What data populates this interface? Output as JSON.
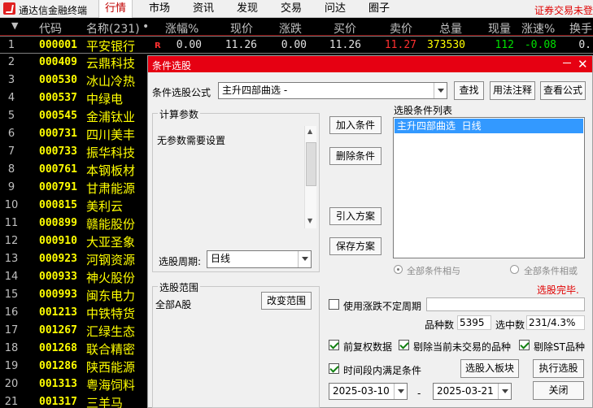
{
  "app": {
    "title": "通达信金融终端",
    "menus": [
      "行情",
      "市场",
      "资讯",
      "发现",
      "交易",
      "问达",
      "圈子"
    ],
    "active_menu": "行情",
    "right_note": "证券交易未登"
  },
  "columns": {
    "sort_arrow": "▼",
    "code": "代码",
    "name": "名称(231)",
    "dot": "•",
    "pct": "涨幅%",
    "price": "现价",
    "chg": "涨跌",
    "bid": "买价",
    "ask": "卖价",
    "vol": "总量",
    "cur": "现量",
    "speed": "涨速%",
    "turn": "换手"
  },
  "stocks": [
    {
      "idx": "1",
      "code": "000001",
      "name": "平安银行",
      "mark": "R",
      "pct": "0.00",
      "price": "11.26",
      "chg": "0.00",
      "bid": "11.26",
      "ask": "11.27",
      "vol": "373530",
      "cur": "112",
      "speed": "-0.08",
      "turn": "0."
    },
    {
      "idx": "2",
      "code": "000409",
      "name": "云鼎科技"
    },
    {
      "idx": "3",
      "code": "000530",
      "name": "冰山冷热"
    },
    {
      "idx": "4",
      "code": "000537",
      "name": "中绿电"
    },
    {
      "idx": "5",
      "code": "000545",
      "name": "金浦钛业"
    },
    {
      "idx": "6",
      "code": "000731",
      "name": "四川美丰"
    },
    {
      "idx": "7",
      "code": "000733",
      "name": "振华科技"
    },
    {
      "idx": "8",
      "code": "000761",
      "name": "本钢板材"
    },
    {
      "idx": "9",
      "code": "000791",
      "name": "甘肃能源"
    },
    {
      "idx": "10",
      "code": "000815",
      "name": "美利云"
    },
    {
      "idx": "11",
      "code": "000899",
      "name": "赣能股份"
    },
    {
      "idx": "12",
      "code": "000910",
      "name": "大亚圣象"
    },
    {
      "idx": "13",
      "code": "000923",
      "name": "河钢资源"
    },
    {
      "idx": "14",
      "code": "000933",
      "name": "神火股份"
    },
    {
      "idx": "15",
      "code": "000993",
      "name": "闽东电力"
    },
    {
      "idx": "16",
      "code": "001213",
      "name": "中铁特货"
    },
    {
      "idx": "17",
      "code": "001267",
      "name": "汇绿生态"
    },
    {
      "idx": "18",
      "code": "001268",
      "name": "联合精密"
    },
    {
      "idx": "19",
      "code": "001286",
      "name": "陕西能源"
    },
    {
      "idx": "20",
      "code": "001313",
      "name": "粤海饲料"
    },
    {
      "idx": "21",
      "code": "001317",
      "name": "三羊马"
    }
  ],
  "colors": {
    "accent": "#e60012",
    "quote_yellow": "#ffff00",
    "quote_red": "#ff3030",
    "quote_green": "#00e000",
    "select_blue": "#3399ff"
  },
  "dialog": {
    "title": "条件选股",
    "formula_label": "条件选股公式",
    "formula_value": "主升四部曲选 -",
    "query_btn": "查找",
    "usage_btn": "用法注释",
    "view_btn": "查看公式",
    "params_group": "计算参数",
    "params_text": "无参数需要设置",
    "period_label": "选股周期:",
    "period_value": "日线",
    "add_btn": "加入条件",
    "del_btn": "删除条件",
    "import_btn": "引入方案",
    "save_btn": "保存方案",
    "list_label": "选股条件列表",
    "list_items": [
      "主升四部曲选  日线"
    ],
    "radio_and": "全部条件相与",
    "radio_or": "全部条件相或",
    "status": "选股完毕.",
    "scope_group": "选股范围",
    "scope_value": "全部A股",
    "scope_btn": "改变范围",
    "use_period_label": "使用涨跌不定周期",
    "count_label": "品种数",
    "count_value": "5395",
    "hit_label": "选中数",
    "hit_value": "231/4.3%",
    "cb_adjust": "前复权数据",
    "cb_untraded": "剔除当前未交易的品种",
    "cb_st": "剔除ST品种",
    "cb_interval": "时间段内满足条件",
    "to_block_btn": "选股入板块",
    "run_btn": "执行选股",
    "date_from": "2025-03-10",
    "date_sep": "-",
    "date_to": "2025-03-21",
    "close_btn": "关闭"
  }
}
